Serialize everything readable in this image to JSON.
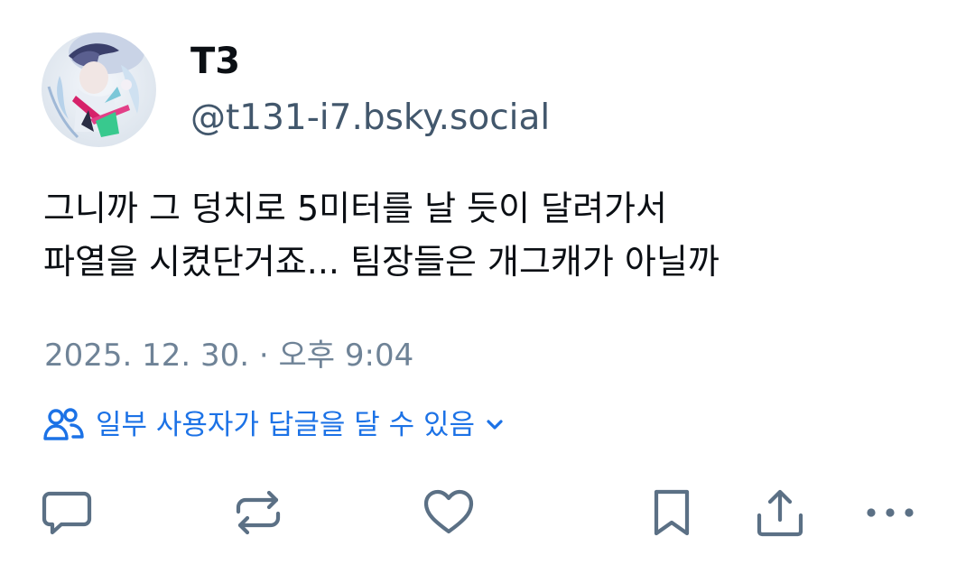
{
  "post": {
    "author": {
      "display_name": "T3",
      "handle": "@t131-i7.bsky.social"
    },
    "text_lines": [
      "그니까 그 덩치로 5미터를 날 듯이 달려가서",
      "파열을 시켰단거죠... 팀장들은 개그캐가 아닐까"
    ],
    "timestamp": "2025. 12. 30. · 오후 9:04",
    "reply_settings": {
      "label": "일부 사용자가 답글을 달 수 있음",
      "icon": "people-icon",
      "color": "#1c72e6"
    },
    "actions": {
      "reply_icon": "comment-icon",
      "repost_icon": "repost-icon",
      "like_icon": "heart-icon",
      "bookmark_icon": "bookmark-icon",
      "share_icon": "share-icon",
      "more_icon": "more-icon",
      "icon_color": "#5b7085"
    }
  }
}
